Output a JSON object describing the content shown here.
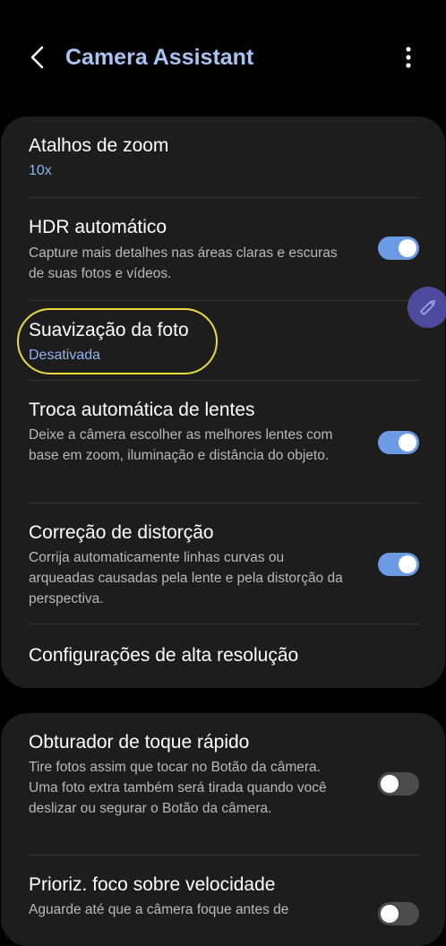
{
  "header": {
    "title": "Camera Assistant"
  },
  "groups": [
    {
      "items": [
        {
          "title": "Atalhos de zoom",
          "value": "10x"
        },
        {
          "title": "HDR automático",
          "description": "Capture mais detalhes nas áreas claras e escuras de suas fotos e vídeos.",
          "toggle": true
        },
        {
          "title": "Suavização da foto",
          "value": "Desativada"
        },
        {
          "title": "Troca automática de lentes",
          "description": "Deixe a câmera escolher as melhores lentes com base em zoom, iluminação e distância do objeto.",
          "toggle": true
        },
        {
          "title": "Correção de distorção",
          "description": "Corrija automaticamente linhas curvas ou arqueadas causadas pela lente e pela distorção da perspectiva.",
          "toggle": true
        },
        {
          "title": "Configurações de alta resolução"
        }
      ]
    },
    {
      "items": [
        {
          "title": "Obturador de toque rápido",
          "description": "Tire fotos assim que tocar no Botão da câmera. Uma foto extra também será tirada quando você deslizar ou segurar o Botão da câmera.",
          "toggle": false
        },
        {
          "title": "Prioriz. foco sobre velocidade",
          "description": "Aguarde até que a câmera foque antes de",
          "toggle": false
        }
      ]
    }
  ],
  "colors": {
    "background": "#000000",
    "card": "#1d1d1d",
    "title_accent": "#a9c3f3",
    "value_accent": "#8fb4ec",
    "toggle_on": "#6b9be4",
    "toggle_off": "#4c4c4c",
    "highlight": "#e7dc3a",
    "fab": "#4d4a9e"
  },
  "icons": {
    "back": "chevron-left-icon",
    "more": "more-vertical-icon",
    "edit": "pencil-icon"
  }
}
